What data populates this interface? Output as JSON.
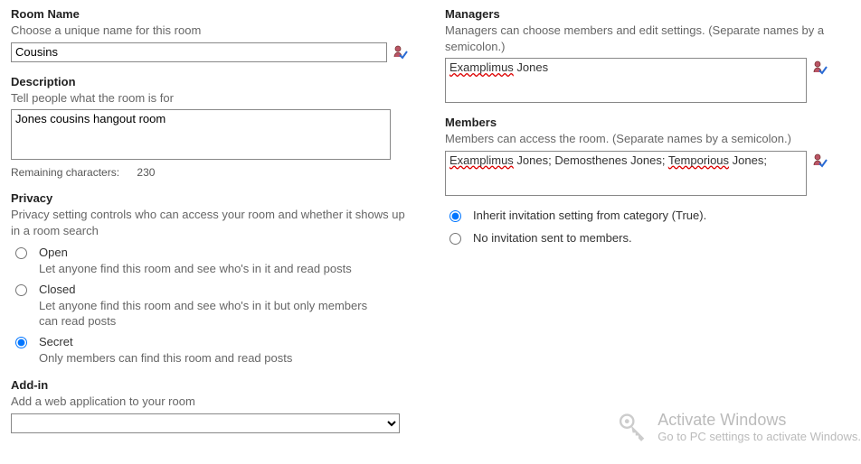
{
  "roomName": {
    "label": "Room Name",
    "hint": "Choose a unique name for this room",
    "value": "Cousins"
  },
  "description": {
    "label": "Description",
    "hint": "Tell people what the room is for",
    "value": "Jones cousins hangout room",
    "remainingLabel": "Remaining characters:",
    "remainingValue": "230"
  },
  "privacy": {
    "label": "Privacy",
    "hint": "Privacy setting controls who can access your room and whether it shows up in a room search",
    "options": [
      {
        "label": "Open",
        "desc": "Let anyone find this room and see who's in it and read posts",
        "selected": false
      },
      {
        "label": "Closed",
        "desc": "Let anyone find this room and see who's in it but only members can read posts",
        "selected": false
      },
      {
        "label": "Secret",
        "desc": "Only members can find this room and read posts",
        "selected": true
      }
    ]
  },
  "addin": {
    "label": "Add-in",
    "hint": "Add a web application to your room",
    "value": ""
  },
  "managers": {
    "label": "Managers",
    "hint": "Managers can choose members and edit settings. (Separate names by a semicolon.)",
    "value": "Examplimus Jones"
  },
  "members": {
    "label": "Members",
    "hint": "Members can access the room. (Separate names by a semicolon.)",
    "value": "Examplimus Jones; Demosthenes Jones; Temporious Jones;"
  },
  "invitation": {
    "options": [
      {
        "label": "Inherit invitation setting from category (True).",
        "selected": true
      },
      {
        "label": "No invitation sent to members.",
        "selected": false
      }
    ]
  },
  "watermark": {
    "title": "Activate Windows",
    "sub": "Go to PC settings to activate Windows."
  }
}
